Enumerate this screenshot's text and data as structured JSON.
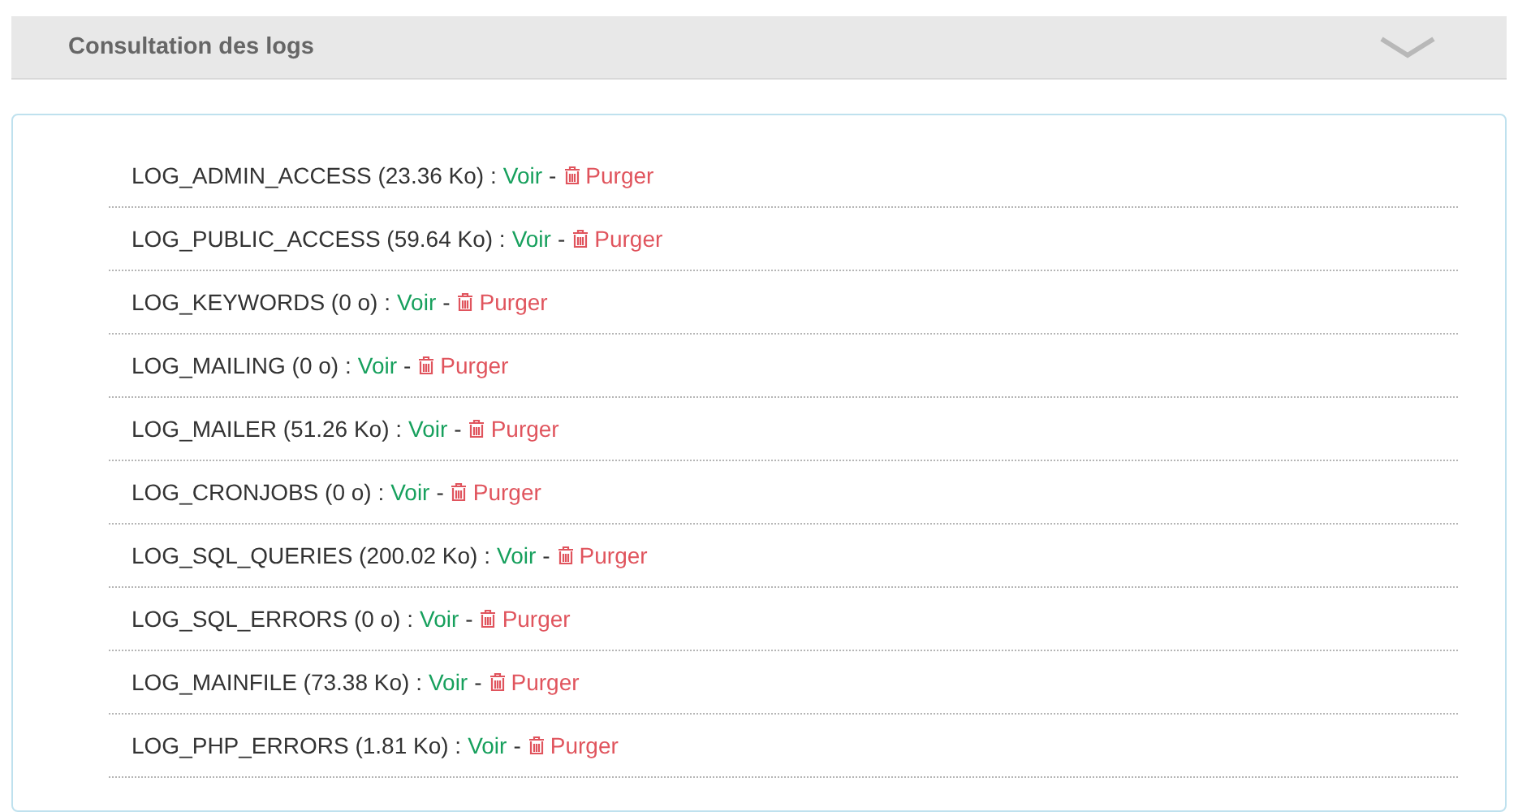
{
  "header": {
    "title": "Consultation des logs",
    "expanded": true
  },
  "logs": [
    {
      "label": "LOG_ADMIN_ACCESS (23.36 Ko) :",
      "view": "Voir",
      "separator": "-",
      "purge": "Purger"
    },
    {
      "label": "LOG_PUBLIC_ACCESS (59.64 Ko) :",
      "view": "Voir",
      "separator": "-",
      "purge": "Purger"
    },
    {
      "label": "LOG_KEYWORDS (0 o) :",
      "view": "Voir",
      "separator": "-",
      "purge": "Purger"
    },
    {
      "label": "LOG_MAILING (0 o) :",
      "view": "Voir",
      "separator": "-",
      "purge": "Purger"
    },
    {
      "label": "LOG_MAILER (51.26 Ko) :",
      "view": "Voir",
      "separator": "-",
      "purge": "Purger"
    },
    {
      "label": "LOG_CRONJOBS (0 o) :",
      "view": "Voir",
      "separator": "-",
      "purge": "Purger"
    },
    {
      "label": "LOG_SQL_QUERIES (200.02 Ko) :",
      "view": "Voir",
      "separator": "-",
      "purge": "Purger"
    },
    {
      "label": "LOG_SQL_ERRORS (0 o) :",
      "view": "Voir",
      "separator": "-",
      "purge": "Purger"
    },
    {
      "label": "LOG_MAINFILE (73.38 Ko) :",
      "view": "Voir",
      "separator": "-",
      "purge": "Purger"
    },
    {
      "label": "LOG_PHP_ERRORS (1.81 Ko) :",
      "view": "Voir",
      "separator": "-",
      "purge": "Purger"
    }
  ]
}
